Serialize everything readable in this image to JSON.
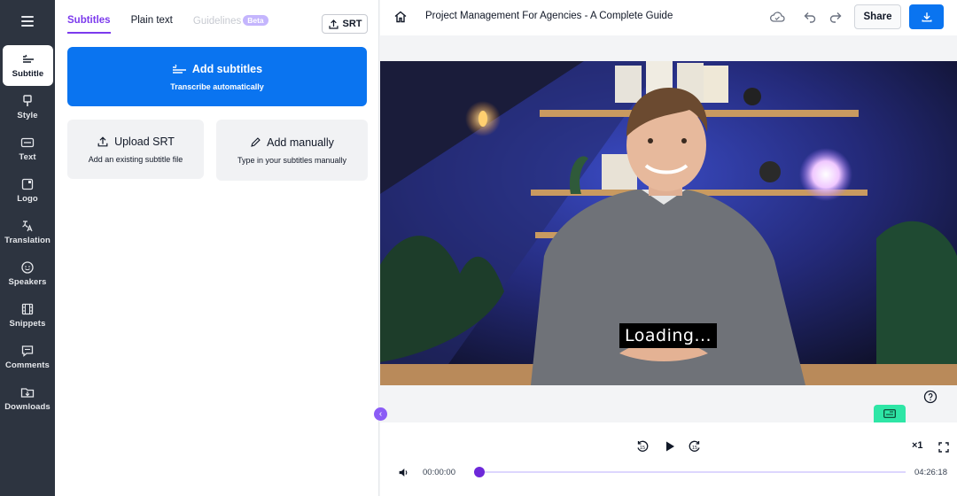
{
  "nav": {
    "items": [
      {
        "id": "subtitle",
        "label": "Subtitle",
        "icon": "subtitle-icon",
        "active": true
      },
      {
        "id": "style",
        "label": "Style",
        "icon": "brush-icon"
      },
      {
        "id": "text",
        "label": "Text",
        "icon": "text-box-icon"
      },
      {
        "id": "logo",
        "label": "Logo",
        "icon": "logo-icon"
      },
      {
        "id": "translation",
        "label": "Translation",
        "icon": "translate-icon"
      },
      {
        "id": "speakers",
        "label": "Speakers",
        "icon": "smiley-icon"
      },
      {
        "id": "snippets",
        "label": "Snippets",
        "icon": "film-icon"
      },
      {
        "id": "comments",
        "label": "Comments",
        "icon": "comment-icon"
      },
      {
        "id": "downloads",
        "label": "Downloads",
        "icon": "folder-download-icon"
      }
    ]
  },
  "panel": {
    "tabs": [
      {
        "label": "Subtitles",
        "state": "active"
      },
      {
        "label": "Plain text",
        "state": "normal"
      },
      {
        "label": "Guidelines",
        "state": "disabled",
        "badge": "Beta"
      }
    ],
    "srt_button": "SRT",
    "add_subtitles": {
      "title": "Add subtitles",
      "subtitle": "Transcribe automatically"
    },
    "upload_srt": {
      "title": "Upload SRT",
      "subtitle": "Add an existing subtitle file"
    },
    "add_manually": {
      "title": "Add manually",
      "subtitle": "Type in your subtitles manually"
    }
  },
  "header": {
    "title": "Project Management For Agencies - A Complete Guide",
    "share_label": "Share"
  },
  "video": {
    "caption": "Loading..."
  },
  "player": {
    "current_time": "00:00:00",
    "duration": "04:26:18",
    "speed": "×1",
    "progress": 0,
    "skip_seconds": "15"
  },
  "colors": {
    "accent": "#7c3aed",
    "primary": "#0a74f0",
    "rail": "#2d3440",
    "marker": "#2ee6a6"
  }
}
